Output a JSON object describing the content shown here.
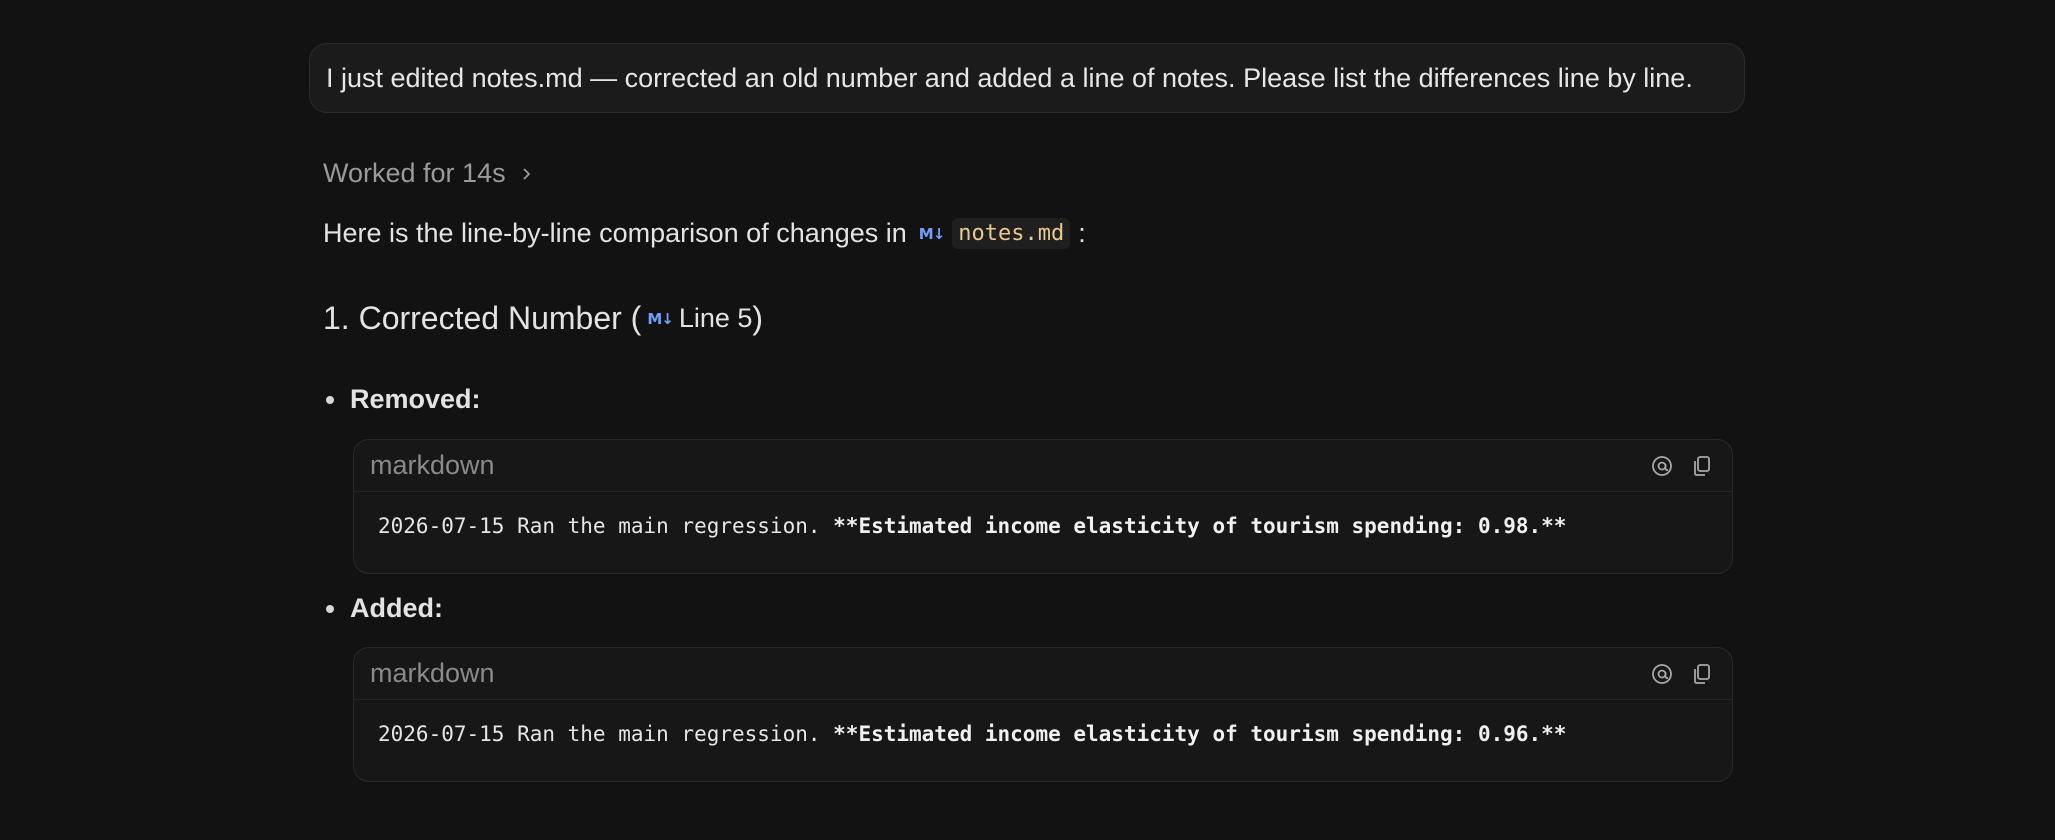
{
  "user_message": "I just edited notes.md — corrected an old number and added a line of notes. Please list the differences line by line.",
  "worked": {
    "label": "Worked for 14s",
    "chevron_icon": "chevron-right-icon"
  },
  "intro": {
    "text": "Here is the line-by-line comparison of changes in",
    "file_icon": "M↓",
    "file_name": "notes.md",
    "suffix": ":"
  },
  "section": {
    "title": "1. Corrected Number (",
    "file_icon": "M↓",
    "line_ref": "Line 5",
    "close": ")"
  },
  "changes": [
    {
      "label": "Removed:",
      "lang": "markdown",
      "code_prefix": "2026-07-15 Ran the main regression. ",
      "code_bold": "**Estimated income elasticity of tourism spending: 0.98.**"
    },
    {
      "label": "Added:",
      "lang": "markdown",
      "code_prefix": "2026-07-15 Ran the main regression. ",
      "code_bold": "**Estimated income elasticity of tourism spending: 0.96.**"
    }
  ],
  "colors": {
    "background": "#121212",
    "file_chip": "#e8c98e",
    "md_icon": "#6ea0ff"
  }
}
